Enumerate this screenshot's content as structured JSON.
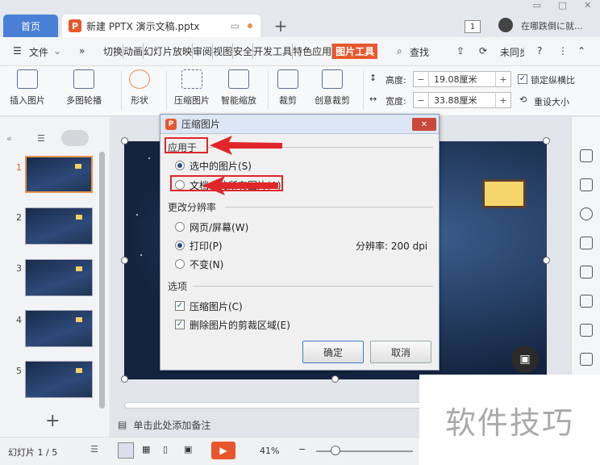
{
  "tabs": {
    "home": "首页",
    "document": "新建 PPTX 演示文稿.pptx",
    "new_tab": "+"
  },
  "topbar": {
    "page_badge": "1",
    "user_text": "在哪跌倒に就..."
  },
  "menubar": {
    "file": "文件",
    "more": "»",
    "tabs": [
      "切换",
      "动画",
      "幻灯片放映",
      "审阅",
      "视图",
      "安全",
      "开发工具",
      "特色应用"
    ],
    "active_tab": "图片工具",
    "search": "查找",
    "unsynced": "未同步"
  },
  "ribbon": {
    "insert_picture": "插入图片",
    "multi_carousel": "多图轮播",
    "shape": "形状",
    "compress": "压缩图片",
    "smart_scale": "智能缩放",
    "crop": "裁剪",
    "creative_crop": "创意裁剪",
    "height_label": "高度:",
    "height_value": "19.08厘米",
    "width_label": "宽度:",
    "width_value": "33.88厘米",
    "lock_ratio": "锁定纵横比",
    "reset_size": "重设大小"
  },
  "slides": {
    "numbers": [
      "1",
      "2",
      "3",
      "4",
      "5"
    ],
    "add": "+"
  },
  "notes_placeholder": "单击此处添加备注",
  "status": {
    "slide_info": "幻灯片 1 / 5",
    "zoom": "41%"
  },
  "dialog": {
    "title": "压缩图片",
    "apply_to_label": "应用于",
    "apply_options": [
      "选中的图片(S)",
      "文档中的所有图片(A)"
    ],
    "apply_selected": 0,
    "resolution_label": "更改分辨率",
    "resolution_options": [
      "网页/屏幕(W)",
      "打印(P)",
      "不变(N)"
    ],
    "resolution_selected": 1,
    "resolution_value": "分辨率:  200 dpi",
    "options_label": "选项",
    "checkboxes": [
      "压缩图片(C)",
      "删除图片的剪裁区域(E)"
    ],
    "ok": "确定",
    "cancel": "取消"
  },
  "watermark": "软件技巧"
}
